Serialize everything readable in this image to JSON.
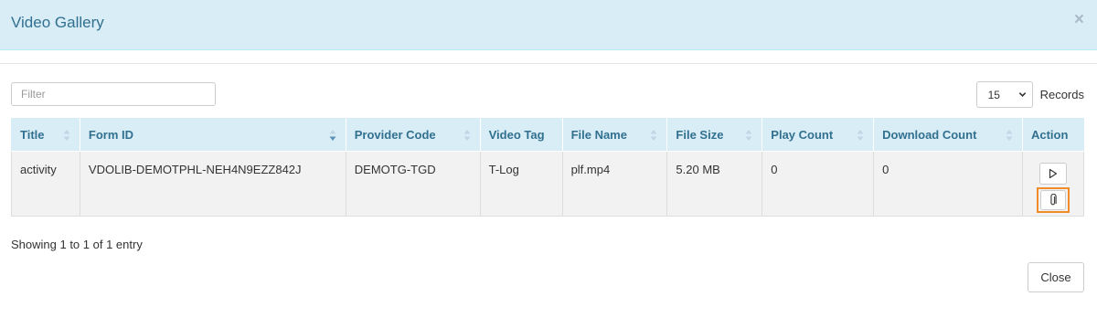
{
  "modal": {
    "title": "Video Gallery",
    "close_glyph": "×"
  },
  "filter": {
    "placeholder": "Filter",
    "value": ""
  },
  "records": {
    "selected": "15",
    "label": "Records"
  },
  "table": {
    "columns": [
      "Title",
      "Form ID",
      "Provider Code",
      "Video Tag",
      "File Name",
      "File Size",
      "Play Count",
      "Download Count",
      "Action"
    ],
    "rows": [
      {
        "title": "activity",
        "form_id": "VDOLIB-DEMOTPHL-NEH4N9EZZ842J",
        "provider_code": "DEMOTG-TGD",
        "video_tag": "T-Log",
        "file_name": "plf.mp4",
        "file_size": "5.20 MB",
        "play_count": "0",
        "download_count": "0",
        "actions": [
          "play-icon",
          "paperclip-icon"
        ]
      }
    ]
  },
  "footer": {
    "info": "Showing 1 to 1 of 1 entry",
    "close_label": "Close"
  },
  "colors": {
    "header_bg": "#d9edf7",
    "header_text": "#31708f",
    "row_bg": "#f2f2f2",
    "highlight": "#f28c28"
  }
}
